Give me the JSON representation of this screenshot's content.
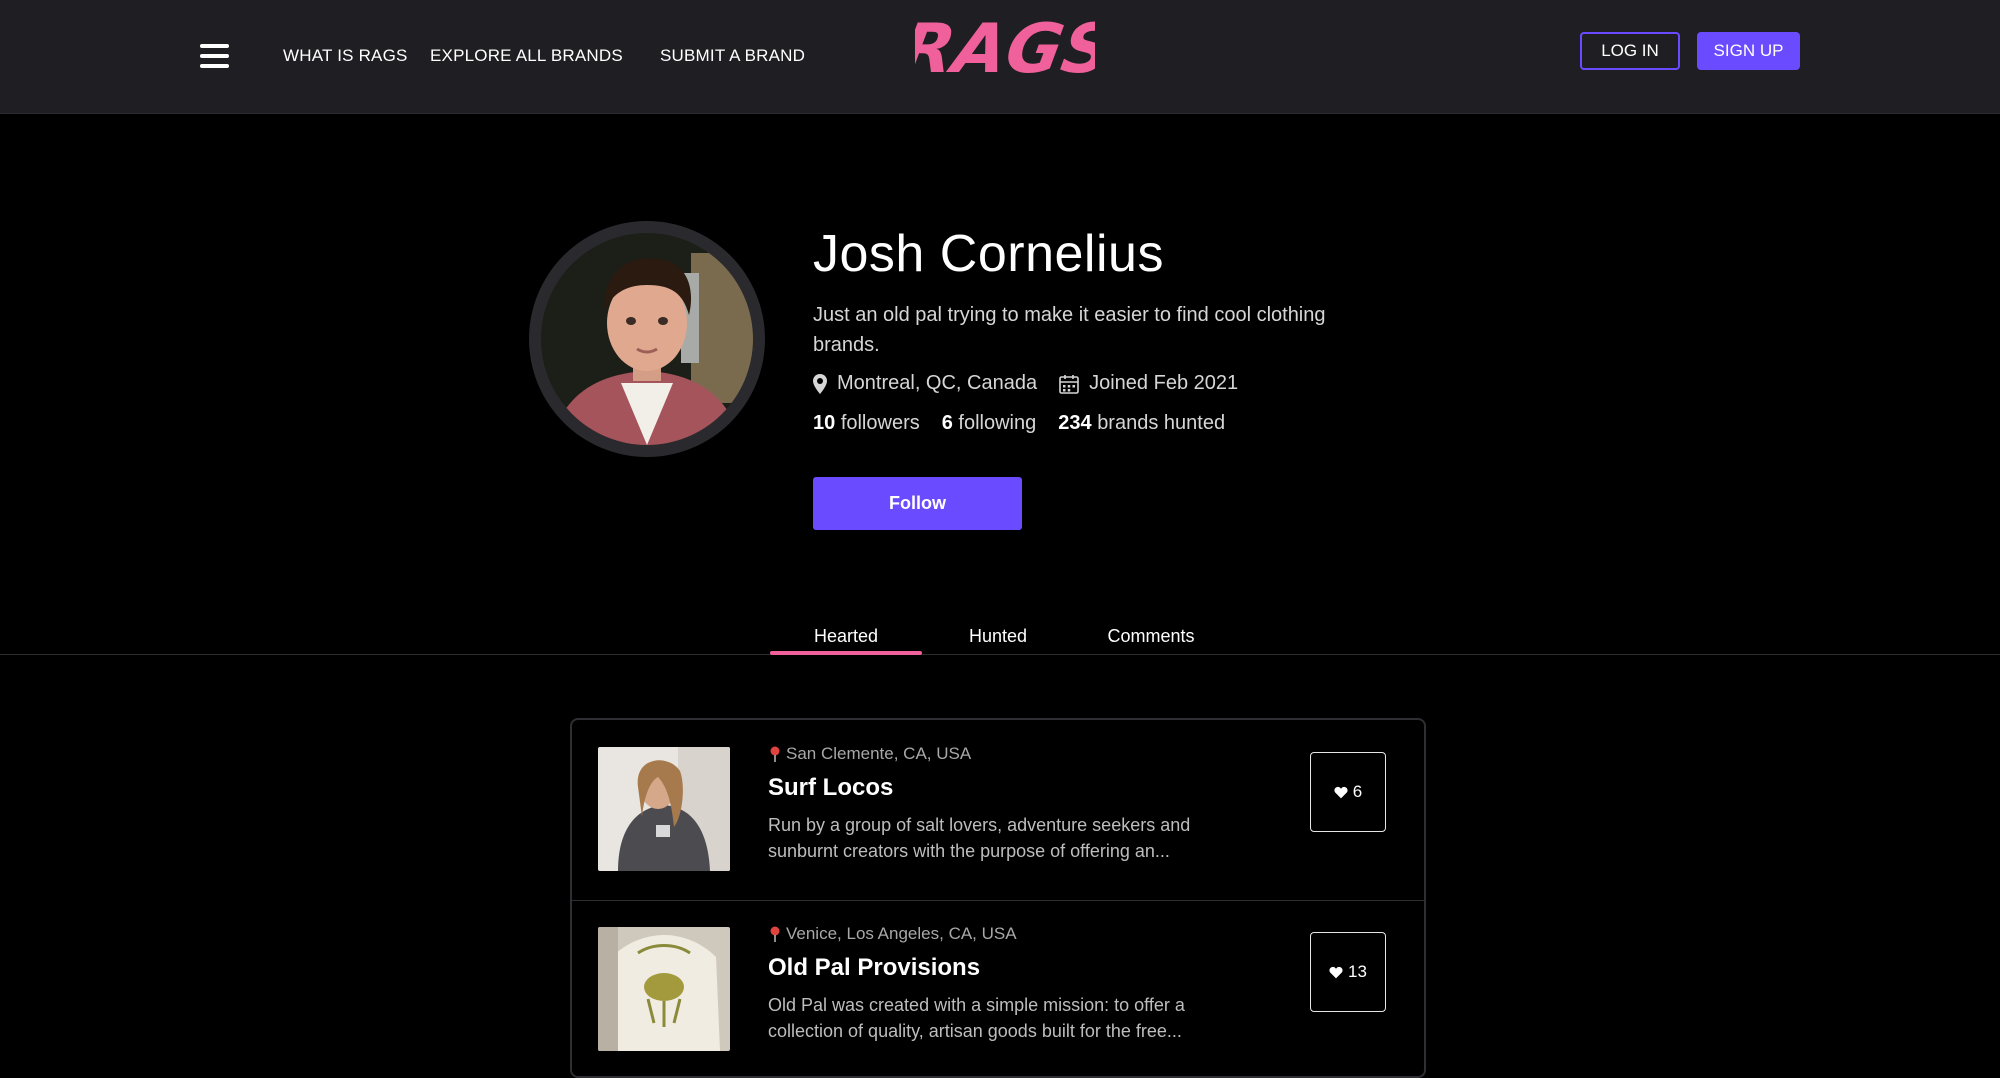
{
  "header": {
    "nav": [
      "WHAT IS RAGS",
      "EXPLORE ALL BRANDS",
      "SUBMIT A BRAND"
    ],
    "logo_text": "RAGS",
    "login_label": "LOG IN",
    "signup_label": "SIGN UP"
  },
  "profile": {
    "name": "Josh Cornelius",
    "bio": "Just an old pal trying to make it easier to find cool clothing brands.",
    "location": "Montreal, QC, Canada",
    "joined": "Joined Feb 2021",
    "followers_count": "10",
    "followers_label": "followers",
    "following_count": "6",
    "following_label": "following",
    "brands_count": "234",
    "brands_label": "brands hunted",
    "follow_label": "Follow"
  },
  "tabs": [
    "Hearted",
    "Hunted",
    "Comments"
  ],
  "active_tab": "Hearted",
  "brands": [
    {
      "location": "San Clemente, CA, USA",
      "name": "Surf Locos",
      "description": "Run by a group of salt lovers, adventure seekers and sunburnt creators with the purpose of offering an...",
      "hearts": "6"
    },
    {
      "location": "Venice, Los Angeles, CA, USA",
      "name": "Old Pal Provisions",
      "description": "Old Pal was created with a simple mission: to offer a collection of quality, artisan goods built for the free...",
      "hearts": "13"
    }
  ],
  "colors": {
    "accent": "#6a4bff",
    "logo": "#f0609a",
    "header_bg": "#1f1f23",
    "page_bg": "#000000"
  }
}
